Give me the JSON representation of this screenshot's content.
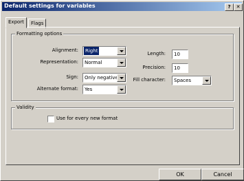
{
  "window": {
    "title": "Default settings for variables",
    "help_btn": "?",
    "close_btn": "✕"
  },
  "tabs": [
    {
      "label": "Export"
    },
    {
      "label": "Flags"
    }
  ],
  "formatting": {
    "group_label": "Formatting options",
    "alignment": {
      "label": "Alignment:",
      "value": "Right"
    },
    "representation": {
      "label": "Representation:",
      "value": "Normal"
    },
    "sign": {
      "label": "Sign:",
      "value": "Only negative"
    },
    "alternate": {
      "label": "Alternate format:",
      "value": "Yes"
    },
    "length": {
      "label": "Length:",
      "value": "10"
    },
    "precision": {
      "label": "Precision:",
      "value": "10"
    },
    "fill": {
      "label": "Fill character:",
      "value": "Spaces"
    }
  },
  "validity": {
    "group_label": "Validity",
    "use_every_new": {
      "label": "Use for every new format",
      "checked": false
    }
  },
  "buttons": {
    "ok": "OK",
    "cancel": "Cancel"
  }
}
